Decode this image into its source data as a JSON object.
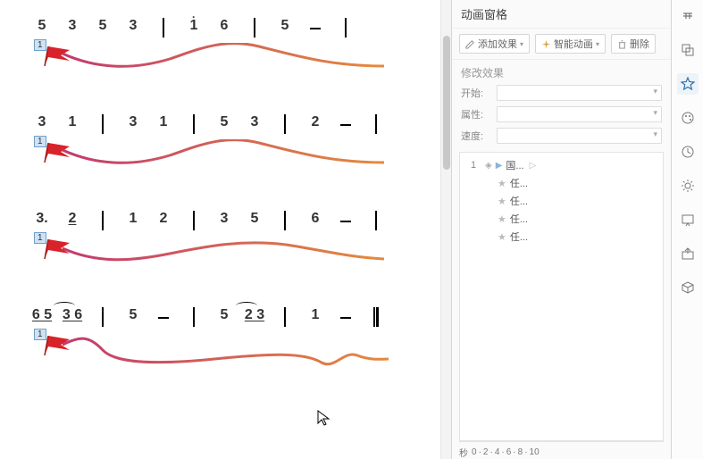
{
  "panel": {
    "title": "动画窗格",
    "toolbar": {
      "add_effect": "添加效果",
      "smart_anim": "智能动画",
      "delete": "删除"
    },
    "section_label": "修改效果",
    "props": {
      "start_label": "开始:",
      "attr_label": "属性:",
      "speed_label": "速度:"
    },
    "items": [
      {
        "idx": "1",
        "label": "国..."
      },
      {
        "label": "任..."
      },
      {
        "label": "任..."
      },
      {
        "label": "任..."
      },
      {
        "label": "任..."
      }
    ],
    "timeline_label": "秒",
    "timeline_ticks": [
      "0",
      "·",
      "2",
      "·",
      "4",
      "·",
      "6",
      "·",
      "8",
      "·",
      "10"
    ]
  },
  "rail": {
    "icons": [
      "settings-icon",
      "layers-icon",
      "animation-icon",
      "palette-icon",
      "clock-icon",
      "gear-icon",
      "slide-icon",
      "export-icon",
      "box-icon"
    ],
    "active_index": 2
  },
  "score": {
    "lines": [
      {
        "flag_index": "1",
        "notes": [
          "5",
          "3",
          "5",
          "3",
          "|",
          "1̇",
          "6",
          "|",
          "5",
          "–",
          "|"
        ]
      },
      {
        "flag_index": "1",
        "notes": [
          "3",
          "1",
          "|",
          "3",
          "1",
          "|",
          "5",
          "3",
          "|",
          "2",
          "–",
          "|"
        ]
      },
      {
        "flag_index": "1",
        "notes": [
          "3.",
          "2̲",
          "|",
          "1",
          "2",
          "|",
          "3",
          "5",
          "|",
          "6",
          "–",
          "|"
        ]
      },
      {
        "flag_index": "1",
        "notes": [
          "6̲5̲",
          "3͡6̲",
          "|",
          "5",
          "–",
          "|",
          "5",
          "2͡3̲",
          "|",
          "1",
          "–",
          "‖"
        ]
      }
    ]
  },
  "chart_data": {
    "type": "table",
    "title": "Numbered musical notation (jianpu) with motion-path waves",
    "lines": [
      [
        "5",
        "3",
        "5",
        "3",
        "|",
        "1(high)",
        "6",
        "|",
        "5",
        "-",
        "|"
      ],
      [
        "3",
        "1",
        "|",
        "3",
        "1",
        "|",
        "5",
        "3",
        "|",
        "2",
        "-",
        "|"
      ],
      [
        "3.",
        "2(underline)",
        "|",
        "1",
        "2",
        "|",
        "3",
        "5",
        "|",
        "6",
        "-",
        "|"
      ],
      [
        "6 5(underline)",
        "3 6(tie,underline)",
        "|",
        "5",
        "-",
        "|",
        "5",
        "2 3(tie,underline)",
        "|",
        "1",
        "-",
        "||"
      ]
    ]
  }
}
